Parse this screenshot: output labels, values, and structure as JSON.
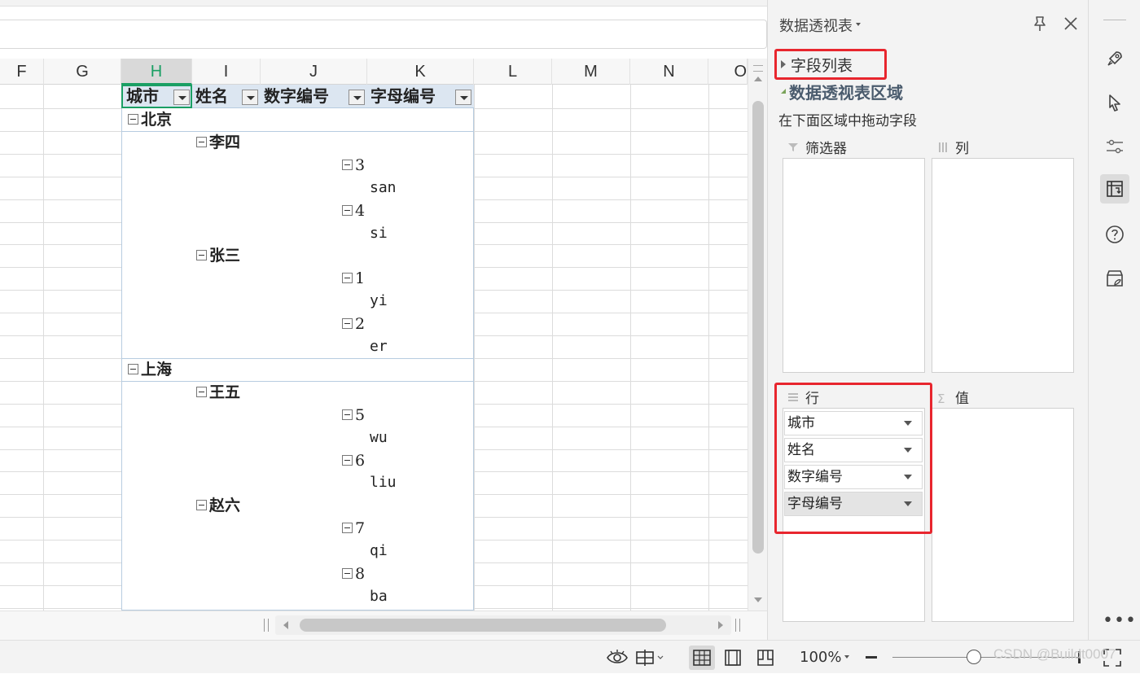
{
  "columns": [
    "F",
    "G",
    "H",
    "I",
    "J",
    "K",
    "L",
    "M",
    "N",
    "O"
  ],
  "pivot": {
    "headers": [
      "城市",
      "姓名",
      "数字编号",
      "字母编号"
    ],
    "rows": [
      {
        "type": "city",
        "text": "北京"
      },
      {
        "type": "name",
        "text": "李四"
      },
      {
        "type": "num",
        "text": "3"
      },
      {
        "type": "letter",
        "text": "san"
      },
      {
        "type": "num",
        "text": "4"
      },
      {
        "type": "letter",
        "text": "si"
      },
      {
        "type": "name",
        "text": "张三"
      },
      {
        "type": "num",
        "text": "1"
      },
      {
        "type": "letter",
        "text": "yi"
      },
      {
        "type": "num",
        "text": "2"
      },
      {
        "type": "letter",
        "text": "er"
      },
      {
        "type": "city",
        "text": "上海"
      },
      {
        "type": "name",
        "text": "王五"
      },
      {
        "type": "num",
        "text": "5"
      },
      {
        "type": "letter",
        "text": "wu"
      },
      {
        "type": "num",
        "text": "6"
      },
      {
        "type": "letter",
        "text": "liu"
      },
      {
        "type": "name",
        "text": "赵六"
      },
      {
        "type": "num",
        "text": "7"
      },
      {
        "type": "letter",
        "text": "qi"
      },
      {
        "type": "num",
        "text": "8"
      },
      {
        "type": "letter",
        "text": "ba"
      }
    ]
  },
  "panel": {
    "title": "数据透视表",
    "field_list_label": "字段列表",
    "area_title": "数据透视表区域",
    "area_hint": "在下面区域中拖动字段",
    "zones": {
      "filter": "筛选器",
      "column": "列",
      "row": "行",
      "value": "值"
    },
    "row_fields": [
      "城市",
      "姓名",
      "数字编号",
      "字母编号"
    ]
  },
  "statusbar": {
    "zoom": "100%"
  },
  "watermark": "CSDN @Buildt0007",
  "colors": {
    "accent_green": "#1a9f64",
    "highlight_red": "#e8262e",
    "pivot_header_bg": "#dce6f1"
  },
  "icons": [
    "pin-icon",
    "close-icon",
    "rocket-icon",
    "cursor-icon",
    "sliders-icon",
    "pivot-icon",
    "help-icon",
    "store-icon",
    "more-icon",
    "eye-icon",
    "freeze-icon",
    "normal-view-icon",
    "page-break-icon",
    "reading-view-icon"
  ]
}
